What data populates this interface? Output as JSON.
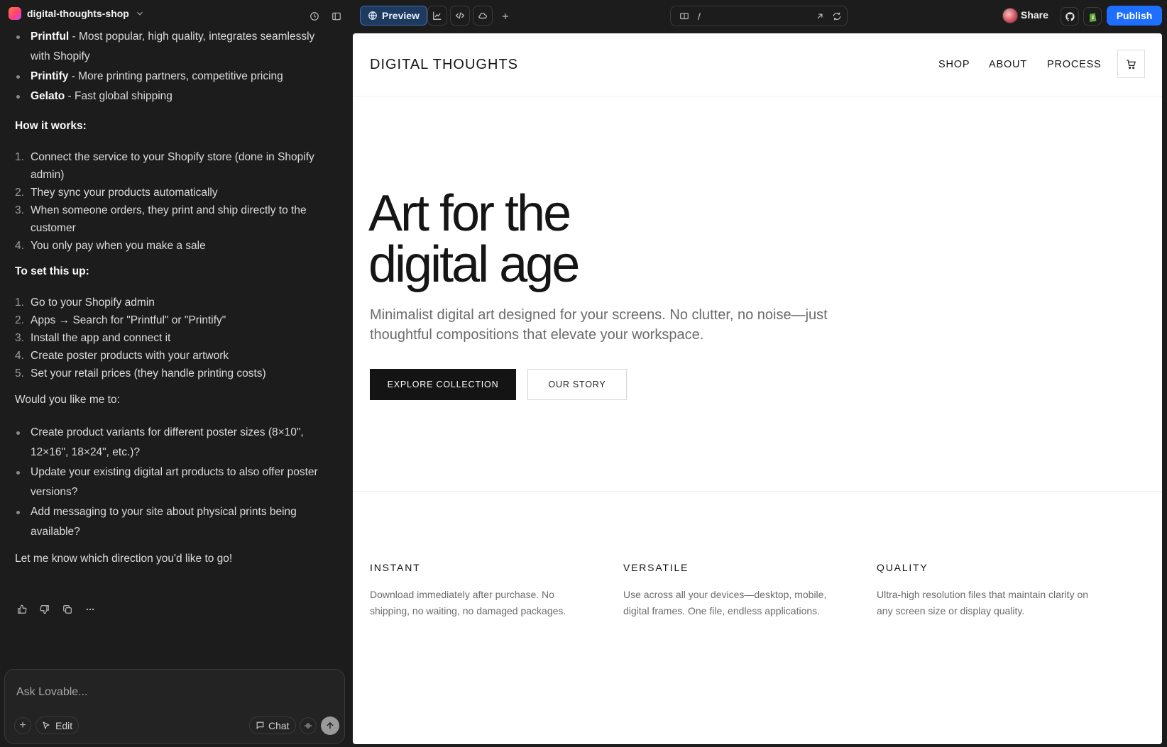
{
  "topbar": {
    "project_name": "digital-thoughts-shop",
    "preview_label": "Preview",
    "url_path": "/",
    "share_label": "Share",
    "publish_label": "Publish"
  },
  "chat": {
    "services": [
      {
        "name": "Printful",
        "desc": " - Most popular, high quality, integrates seamlessly with Shopify"
      },
      {
        "name": "Printify",
        "desc": " - More printing partners, competitive pricing"
      },
      {
        "name": "Gelato",
        "desc": " - Fast global shipping"
      }
    ],
    "how_heading": "How it works:",
    "how_steps": [
      "Connect the service to your Shopify store (done in Shopify admin)",
      "They sync your products automatically",
      "When someone orders, they print and ship directly to the customer",
      "You only pay when you make a sale"
    ],
    "setup_heading": "To set this up:",
    "setup_steps": [
      "Go to your Shopify admin",
      "Apps → Search for \"Printful\" or \"Printify\"",
      "Install the app and connect it",
      "Create poster products with your artwork",
      "Set your retail prices (they handle printing costs)"
    ],
    "question": "Would you like me to:",
    "options": [
      "Create product variants for different poster sizes (8×10\", 12×16\", 18×24\", etc.)?",
      "Update your existing digital art products to also offer poster versions?",
      "Add messaging to your site about physical prints being available?"
    ],
    "closing": "Let me know which direction you'd like to go!",
    "composer_placeholder": "Ask Lovable...",
    "edit_label": "Edit",
    "chat_label": "Chat"
  },
  "site": {
    "brand": "DIGITAL THOUGHTS",
    "nav": [
      "SHOP",
      "ABOUT",
      "PROCESS"
    ],
    "hero_line1": "Art for the",
    "hero_line2": "digital age",
    "hero_sub": "Minimalist digital art designed for your screens. No clutter, no noise—just thoughtful compositions that elevate your workspace.",
    "cta_primary": "EXPLORE COLLECTION",
    "cta_secondary": "OUR STORY",
    "features": [
      {
        "title": "INSTANT",
        "text": "Download immediately after purchase. No shipping, no waiting, no damaged packages."
      },
      {
        "title": "VERSATILE",
        "text": "Use across all your devices—desktop, mobile, digital frames. One file, endless applications."
      },
      {
        "title": "QUALITY",
        "text": "Ultra-high resolution files that maintain clarity on any screen size or display quality."
      }
    ]
  },
  "colors": {
    "publish": "#1f6fff",
    "preview_active": "#1f3a5f",
    "cta_dark": "#141414"
  }
}
